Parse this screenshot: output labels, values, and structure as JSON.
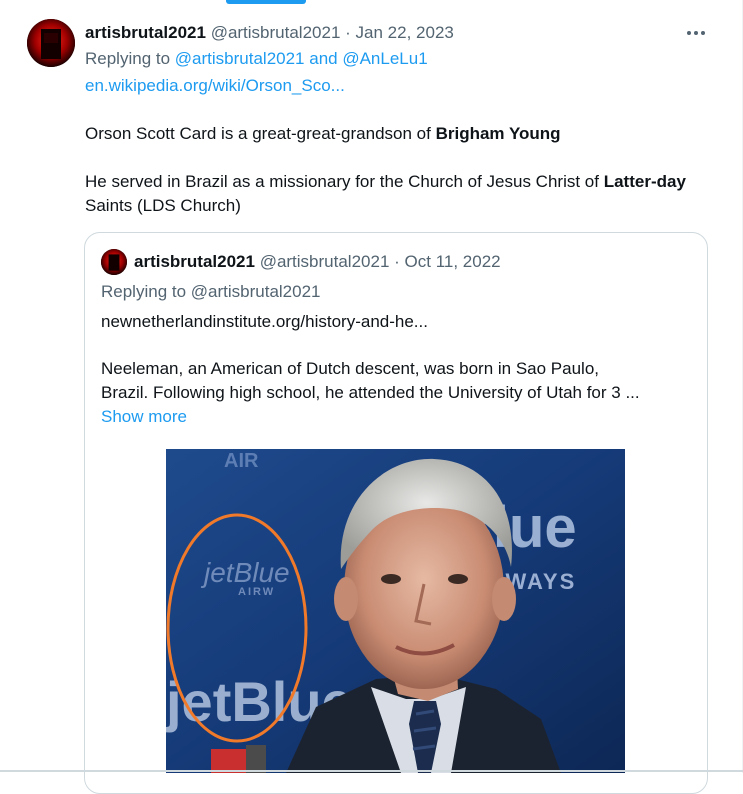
{
  "tweet": {
    "author_name": "artisbrutal2021",
    "author_handle": "@artisbrutal2021",
    "separator": "·",
    "date": "Jan 22, 2023",
    "replying_prefix": "Replying to",
    "replying_users": "@artisbrutal2021 and @AnLeLu1",
    "link": "en.wikipedia.org/wiki/Orson_Sco...",
    "para1_text": "Orson Scott Card is a great-great-grandson of",
    "para1_bold": "Brigham Young",
    "para2_text": "He served in Brazil as a missionary for the Church of Jesus Christ of",
    "para2_bold": "Latter-day",
    "para2_tail": "Saints (LDS Church)",
    "more_icon": "ellipsis-icon"
  },
  "quote": {
    "author_name": "artisbrutal2021",
    "author_handle": "@artisbrutal2021",
    "separator": "·",
    "date": "Oct 11, 2022",
    "replying": "Replying to @artisbrutal2021",
    "link": "newnetherlandinstitute.org/history-and-he...",
    "text_line1": "Neeleman, an American of Dutch descent, was born in Sao Paulo,",
    "text_line2": "Brazil. Following high school, he attended the University of Utah for 3 ...",
    "show_more": "Show more",
    "photo_texts": {
      "logo_top_right": "Blue",
      "airways": "AIRWAYS",
      "logo_left_small": "jetBlue",
      "logo_left_sub": "AIRW",
      "logo_bottom_left": "jetBlue",
      "top_left_partial": "AIR"
    }
  },
  "colors": {
    "accent": "#1d9bf0",
    "muted": "#536471",
    "text": "#0f1419",
    "annotation_circle": "#f07a2a",
    "photo_bg": "#13356e"
  }
}
